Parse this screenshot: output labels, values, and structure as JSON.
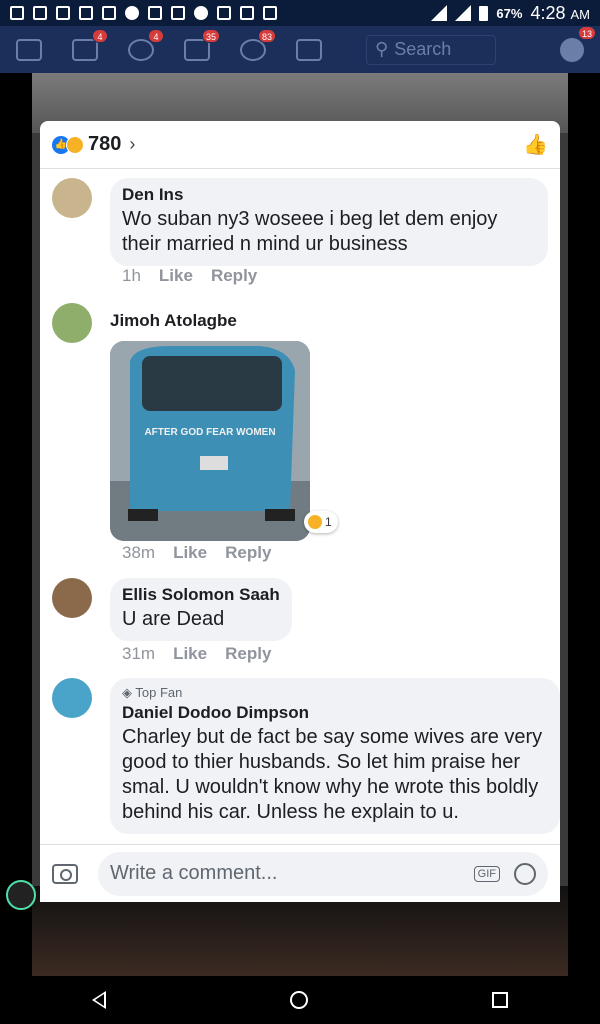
{
  "statusbar": {
    "battery": "67%",
    "time": "4:28",
    "ampm": "AM"
  },
  "nav": {
    "search_placeholder": "Search",
    "badges": {
      "friends": "4",
      "groups": "4",
      "messages": "35",
      "notifications": "83",
      "messenger": "13"
    }
  },
  "reactions": {
    "count": "780",
    "types": [
      "like-icon",
      "haha-icon"
    ]
  },
  "comments": [
    {
      "name": "Den Ins",
      "text": "Wo suban ny3 woseee i beg let dem enjoy their married n mind ur business",
      "time": "1h",
      "like": "Like",
      "reply": "Reply"
    },
    {
      "name": "Jimoh Atolagbe",
      "photo_text": "AFTER GOD FEAR WOMEN",
      "reaction_count": "1",
      "time": "38m",
      "like": "Like",
      "reply": "Reply"
    },
    {
      "name": "Ellis Solomon Saah",
      "text": "U are Dead",
      "time": "31m",
      "like": "Like",
      "reply": "Reply"
    },
    {
      "badge": "Top Fan",
      "name": "Daniel Dodoo Dimpson",
      "text": "Charley but de fact be say some wives are very good to thier husbands. So let him praise her smal. U wouldn't know why he wrote this boldly behind his car. Unless he explain to u."
    }
  ],
  "composer": {
    "placeholder": "Write a comment...",
    "gif_label": "GIF"
  }
}
